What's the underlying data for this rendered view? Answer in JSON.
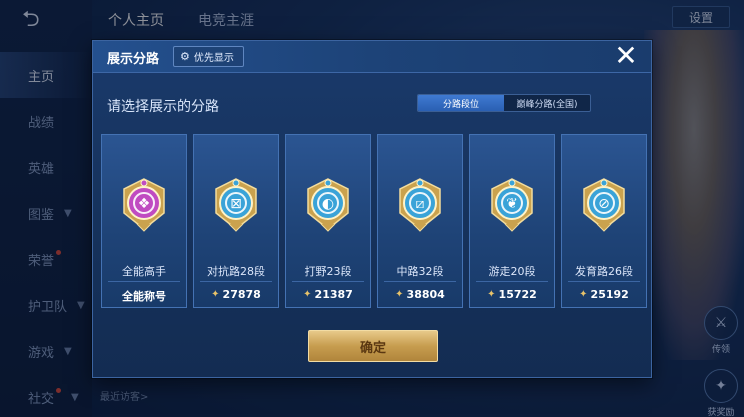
{
  "background": {
    "top_tabs": [
      "个人主页",
      "电竞主涯"
    ],
    "sidebar": [
      {
        "label": "主页",
        "active": true
      },
      {
        "label": "战绩"
      },
      {
        "label": "英雄"
      },
      {
        "label": "图鉴",
        "chevron": true
      },
      {
        "label": "荣誉",
        "badge": true
      },
      {
        "label": "护卫队",
        "chevron": true
      },
      {
        "label": "游戏",
        "chevron": true
      },
      {
        "label": "社交",
        "badge": true,
        "chevron": true
      }
    ],
    "settings_label": "设置",
    "bottom_hint": "最近访客>",
    "right_buttons": [
      {
        "label": "传领"
      },
      {
        "label": "获奖励"
      }
    ]
  },
  "modal": {
    "title": "展示分路",
    "priority_label": "优先显示",
    "subtitle": "请选择展示的分路",
    "toggle": [
      "分路段位",
      "巅峰分路(全国)"
    ],
    "toggle_active": 0,
    "confirm_label": "确定",
    "cards": [
      {
        "name": "全能高手",
        "bottom": "全能称号",
        "is_title": true,
        "emblem": "all-round",
        "color": "#c04bc1"
      },
      {
        "name": "对抗路28段",
        "bottom": "27878",
        "emblem": "clash-lane",
        "color": "#3aa3d8"
      },
      {
        "name": "打野23段",
        "bottom": "21387",
        "emblem": "jungle",
        "color": "#3aa3d8"
      },
      {
        "name": "中路32段",
        "bottom": "38804",
        "emblem": "mid-lane",
        "color": "#3aa3d8"
      },
      {
        "name": "游走20段",
        "bottom": "15722",
        "emblem": "roam",
        "color": "#3aa3d8"
      },
      {
        "name": "发育路26段",
        "bottom": "25192",
        "emblem": "farm-lane",
        "color": "#3aa3d8"
      }
    ]
  }
}
